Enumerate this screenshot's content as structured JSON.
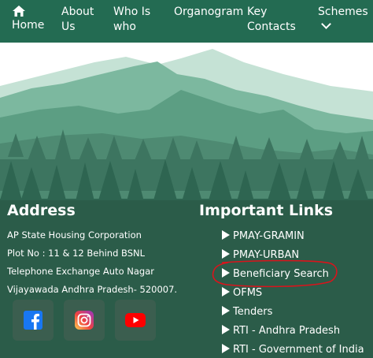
{
  "nav": {
    "home_label": "Home",
    "about_label": "About Us",
    "who_label": "Who Is who",
    "organogram_label": "Organogram",
    "key_contacts_label": "Key Contacts",
    "schemes_label": "Schemes"
  },
  "footer": {
    "address_heading": "Address",
    "address_lines": [
      "AP State Housing Corporation",
      "Plot No : 11 & 12 Behind BSNL",
      "Telephone Exchange Auto Nagar",
      "Vijayawada Andhra Pradesh- 520007."
    ],
    "social": [
      "facebook-icon",
      "instagram-icon",
      "youtube-icon"
    ],
    "links_heading": "Important Links",
    "links": [
      "PMAY-GRAMIN",
      "PMAY-URBAN",
      "Beneficiary Search",
      "OFMS",
      "Tenders",
      "RTI - Andhra Pradesh",
      "RTI - Government of India"
    ]
  },
  "colors": {
    "nav_bg": "#236b52",
    "footer_dark": "#2e5d4b",
    "annotation_red": "#d9141c"
  }
}
